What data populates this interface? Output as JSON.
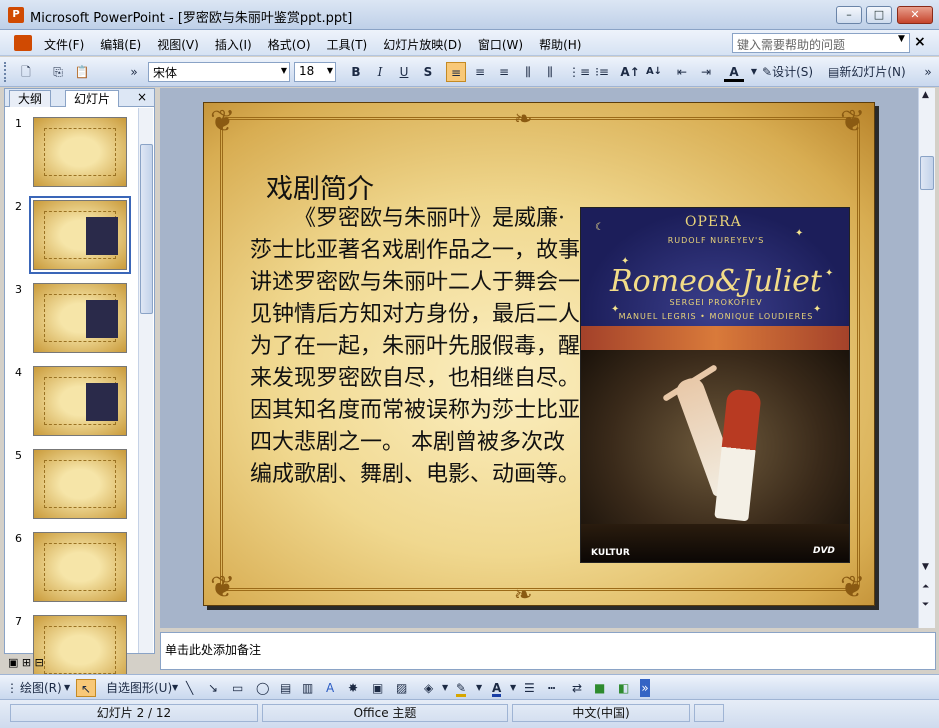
{
  "window": {
    "title": "Microsoft PowerPoint - [罗密欧与朱丽叶鉴赏ppt.ppt]",
    "minimize": "–",
    "maximize": "□",
    "close": "✕"
  },
  "menu": {
    "items": [
      "文件(F)",
      "编辑(E)",
      "视图(V)",
      "插入(I)",
      "格式(O)",
      "工具(T)",
      "幻灯片放映(D)",
      "窗口(W)",
      "帮助(H)"
    ],
    "help_placeholder": "键入需要帮助的问题"
  },
  "toolbar": {
    "font_name": "宋体",
    "font_size": "18",
    "bold": "B",
    "italic": "I",
    "underline": "U",
    "shadow": "S",
    "design_label": "设计(S)",
    "new_slide_label": "新幻灯片(N)"
  },
  "panel": {
    "tab_outline": "大纲",
    "tab_slides": "幻灯片",
    "close": "×",
    "thumbnails": [
      "1",
      "2",
      "3",
      "4",
      "5",
      "6",
      "7"
    ],
    "selected_index": 2
  },
  "slide": {
    "title": "戏剧简介",
    "body": "《罗密欧与朱丽叶》是威廉·莎士比亚著名戏剧作品之一，故事讲述罗密欧与朱丽叶二人于舞会一见钟情后方知对方身份，最后二人为了在一起，朱丽叶先服假毒，醒来发现罗密欧自尽，也相继自尽。因其知名度而常被误称为莎士比亚四大悲剧之一。 本剧曾被多次改编成歌剧、舞剧、电影、动画等。",
    "poster": {
      "opera": "OPERA",
      "credit_top": "RUDOLF NUREYEV'S",
      "name": "Romeo&Juliet",
      "composer": "SERGEI PROKOFIEV",
      "cast": "MANUEL LEGRIS • MONIQUE LOUDIERES",
      "brand": "KULTUR",
      "dvd": "DVD"
    }
  },
  "notes": {
    "placeholder": "单击此处添加备注"
  },
  "drawbar": {
    "draw_label": "绘图(R)",
    "autoshape_label": "自选图形(U)"
  },
  "status": {
    "slide_position": "幻灯片 2 / 12",
    "theme": "Office 主题",
    "language": "中文(中国)"
  },
  "colors": {
    "accent": "#f8c878",
    "title_bar": "#dce6f4",
    "close_button": "#c5442c"
  }
}
